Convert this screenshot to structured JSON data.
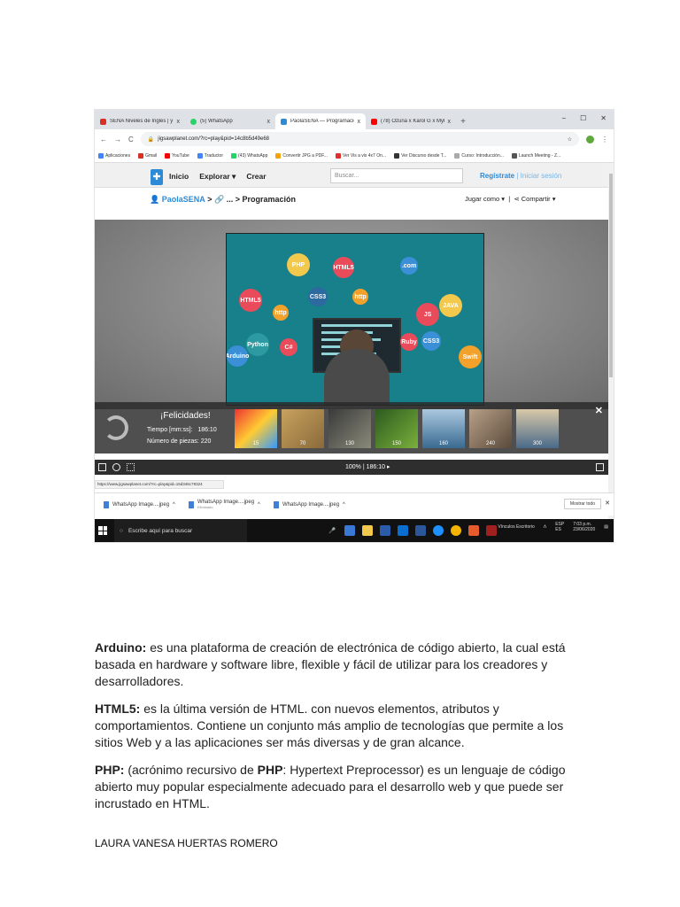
{
  "browser": {
    "tabs": [
      {
        "title": "SENA Niveles de Inglés | y Nivel",
        "close": "x",
        "color": "#d93025"
      },
      {
        "title": "(5) WhatsApp",
        "close": "x",
        "color": "#25d366"
      },
      {
        "title": "PaolaSENA — Programación",
        "close": "x",
        "color": "#2c8ad6"
      },
      {
        "title": "(78) Ozuna x Karol G x Myke Tow",
        "close": "x",
        "color": "#ff0000"
      }
    ],
    "new_tab": "+",
    "window_controls": [
      "−",
      "☐",
      "✕"
    ],
    "nav": {
      "back": "←",
      "forward": "→",
      "reload": "C"
    },
    "url": "jigsawplanet.com/?rc=play&pid=14c8b5d49e68",
    "bookmarks": [
      {
        "label": "Aplicaciones",
        "color": "#4285f4"
      },
      {
        "label": "Gmail",
        "color": "#d93025"
      },
      {
        "label": "YouTube",
        "color": "#ff0000"
      },
      {
        "label": "Traductor",
        "color": "#4285f4"
      },
      {
        "label": "(43) WhatsApp",
        "color": "#25d366"
      },
      {
        "label": "Convertir JPG a PDF...",
        "color": "#f4a30b"
      },
      {
        "label": "Ver Vis a vis 4x7 On...",
        "color": "#e0302b"
      },
      {
        "label": "Ver Discurso desde T...",
        "color": "#333333"
      },
      {
        "label": "Curso: Introducción...",
        "color": "#aaaaaa"
      },
      {
        "label": "Launch Meeting - Z...",
        "color": "#555555"
      }
    ]
  },
  "site": {
    "nav": [
      "Inicio",
      "Explorar ▾",
      "Crear"
    ],
    "search_placeholder": "Buscar...",
    "register": "Regístrate",
    "login": "| Iniciar sesión",
    "breadcrumb_user": "PaolaSENA",
    "breadcrumb_rest": " > 🔗 ... > Programación",
    "play_as": "Jugar como ▾",
    "share": "Compartir ▾",
    "status_url": "https://www.jigsawplanet.com/?rc=play&pid=15d346c78324"
  },
  "puzzle": {
    "bubbles": [
      "PHP",
      "HTML5",
      ".com",
      "HTML5",
      "CSS3",
      "http",
      "JS",
      "JAVA",
      "http",
      "Python",
      "C#",
      "Arduino",
      "Ruby",
      "CSS3",
      "Swift"
    ],
    "congrats_title": "¡Felicidades!",
    "time_label": "Tiempo [mm:ss]:",
    "time_value": "186:10",
    "pieces_label": "Número de piezas:",
    "pieces_value": "220",
    "thumbs": [
      "15",
      "70",
      "130",
      "150",
      "160",
      "240",
      "300"
    ],
    "zoom": "100% | 186:10 ▸",
    "close": "✕"
  },
  "downloads": [
    {
      "name": "WhatsApp Image....jpeg",
      "sub": ""
    },
    {
      "name": "WhatsApp Image....jpeg",
      "sub": "Eliminado"
    },
    {
      "name": "WhatsApp Image....jpeg",
      "sub": ""
    }
  ],
  "downloads_show_all": "Mostrar todo",
  "taskbar": {
    "search": "Escribe aquí para buscar",
    "tray_label": "Vínculos  Escritorio",
    "lang": "ESP\nES",
    "time": "7:03 p.m.",
    "date": "23/06/2020"
  },
  "text": {
    "p1_term": "Arduino:",
    "p1": " es una plataforma de creación de electrónica de código abierto, la cual está basada en hardware y software libre, flexible y fácil de utilizar para los creadores y desarrolladores.",
    "p2_term": "HTML5:",
    "p2": " es la última versión de HTML. con nuevos elementos, atributos y comportamientos. Contiene un conjunto más amplio de tecnologías que permite a los sitios Web y a las aplicaciones ser más diversas y de gran alcance.",
    "p3_term": "PHP:",
    "p3a": " (acrónimo recursivo de ",
    "p3_term2": "PHP",
    "p3b": ": Hypertext Preprocessor) es un lenguaje de código abierto muy popular especialmente adecuado para el desarrollo web y que puede ser incrustado en HTML.",
    "author": "LAURA VANESA HUERTAS ROMERO"
  }
}
